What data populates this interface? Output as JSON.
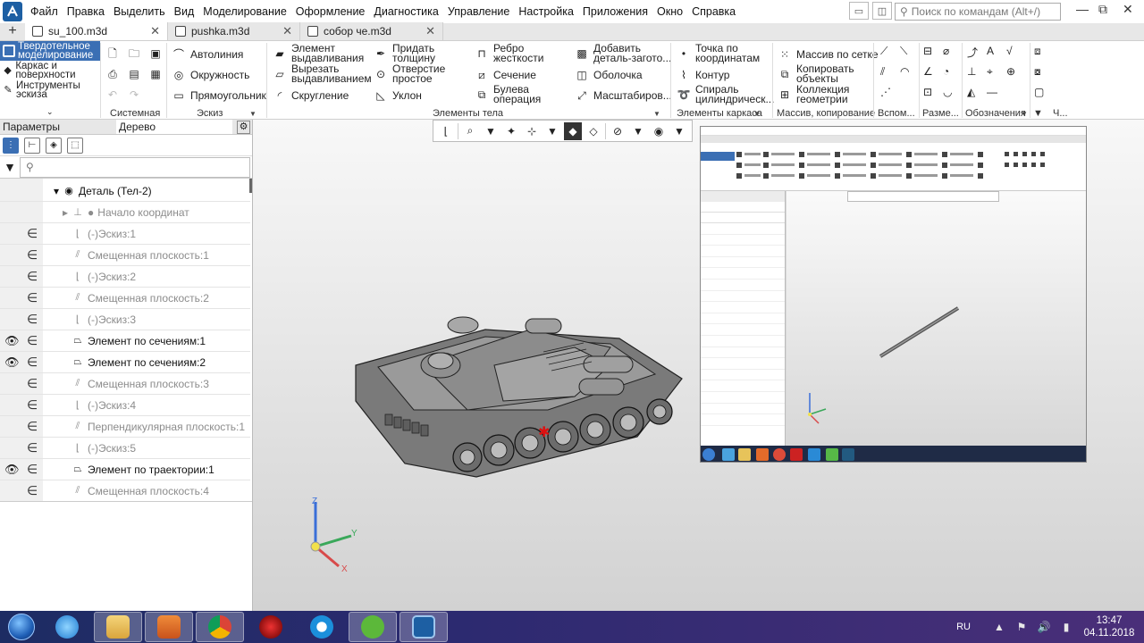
{
  "menubar": {
    "items": [
      "Файл",
      "Правка",
      "Выделить",
      "Вид",
      "Моделирование",
      "Оформление",
      "Диагностика",
      "Управление",
      "Настройка",
      "Приложения",
      "Окно",
      "Справка"
    ],
    "search_placeholder": "Поиск по командам (Alt+/)"
  },
  "tabs": [
    {
      "label": "su_100.m3d",
      "active": true
    },
    {
      "label": "pushka.m3d",
      "active": false
    },
    {
      "label": "собор че.m3d",
      "active": false
    }
  ],
  "ribbon": {
    "modes": [
      "Твердотельное моделирование",
      "Каркас и поверхности",
      "Инструменты эскиза"
    ],
    "sistemnaya_label": "Системная",
    "eskiz": {
      "label": "Эскиз",
      "items": [
        "Автолиния",
        "Окружность",
        "Прямоугольник"
      ]
    },
    "elements": {
      "label": "Элементы тела",
      "col1": [
        "Элемент выдавливания",
        "Вырезать выдавливанием",
        "Скругление"
      ],
      "col2": [
        "Придать толщину",
        "Отверстие простое",
        "Уклон"
      ],
      "col3": [
        "Ребро жесткости",
        "Сечение",
        "Булева операция"
      ],
      "col4": [
        "Добавить деталь-загото...",
        "Оболочка",
        "Масштабиров..."
      ]
    },
    "karkas": {
      "label": "Элементы каркаса",
      "items": [
        "Точка по координатам",
        "Контур",
        "Спираль цилиндрическ..."
      ]
    },
    "massiv": {
      "label": "Массив, копирование",
      "items": [
        "Массив по сетке",
        "Копировать объекты",
        "Коллекция геометрии"
      ]
    },
    "vspom_label": "Вспом...",
    "razme_label": "Разме...",
    "oboznach_label": "Обозначения",
    "ch_label": "Ч..."
  },
  "panel": {
    "tab_params": "Параметры",
    "tab_tree": "Дерево",
    "filter_placeholder": "",
    "tree": [
      {
        "label": "Деталь (Тел-2)",
        "style": "bold",
        "eye": false,
        "rel": false
      },
      {
        "label": "Начало координат",
        "style": "grey",
        "eye": false,
        "rel": false
      },
      {
        "label": "(-)Эскиз:1",
        "style": "grey",
        "eye": false,
        "rel": true
      },
      {
        "label": "Смещенная плоскость:1",
        "style": "grey",
        "eye": false,
        "rel": true
      },
      {
        "label": "(-)Эскиз:2",
        "style": "grey",
        "eye": false,
        "rel": true
      },
      {
        "label": "Смещенная плоскость:2",
        "style": "grey",
        "eye": false,
        "rel": true
      },
      {
        "label": "(-)Эскиз:3",
        "style": "grey",
        "eye": false,
        "rel": true
      },
      {
        "label": "Элемент по сечениям:1",
        "style": "bold",
        "eye": true,
        "rel": true
      },
      {
        "label": "Элемент по сечениям:2",
        "style": "bold",
        "eye": true,
        "rel": true
      },
      {
        "label": "Смещенная плоскость:3",
        "style": "grey",
        "eye": false,
        "rel": true
      },
      {
        "label": "(-)Эскиз:4",
        "style": "grey",
        "eye": false,
        "rel": true
      },
      {
        "label": "Перпендикулярная плоскость:1",
        "style": "grey",
        "eye": false,
        "rel": true
      },
      {
        "label": "(-)Эскиз:5",
        "style": "grey",
        "eye": false,
        "rel": true
      },
      {
        "label": "Элемент по траектории:1",
        "style": "bold",
        "eye": true,
        "rel": true
      },
      {
        "label": "Смещенная плоскость:4",
        "style": "grey",
        "eye": false,
        "rel": true
      }
    ]
  },
  "axes": {
    "x": "X",
    "y": "Y",
    "z": "Z"
  },
  "taskbar": {
    "lang": "RU",
    "time": "13:47",
    "date": "04.11.2018"
  },
  "colors": {
    "accent": "#3b6fb4",
    "model": "#6f6f6f"
  }
}
